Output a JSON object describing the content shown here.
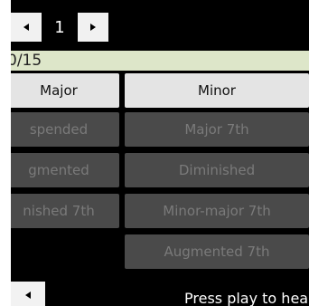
{
  "pager": {
    "prev_icon": "arrow-left-icon",
    "page": "1",
    "next_icon": "arrow-right-icon"
  },
  "progress": {
    "text": "0/15"
  },
  "chords": {
    "left": [
      {
        "label": "Major",
        "state": "active"
      },
      {
        "label": "spended",
        "state": "disabled"
      },
      {
        "label": "gmented",
        "state": "disabled"
      },
      {
        "label": "nished 7th",
        "state": "disabled"
      }
    ],
    "right": [
      {
        "label": "Minor",
        "state": "active"
      },
      {
        "label": "Major 7th",
        "state": "disabled"
      },
      {
        "label": "Diminished",
        "state": "disabled"
      },
      {
        "label": "Minor-major 7th",
        "state": "disabled"
      },
      {
        "label": "Augmented 7th",
        "state": "disabled"
      }
    ]
  },
  "footer": {
    "back_icon": "arrow-left-icon",
    "hint": "Press play to hea"
  },
  "colors": {
    "background": "#000000",
    "progress_bar": "#dde6c9",
    "button_active": "#e4e4e4",
    "button_disabled": "#4a4a4a"
  }
}
